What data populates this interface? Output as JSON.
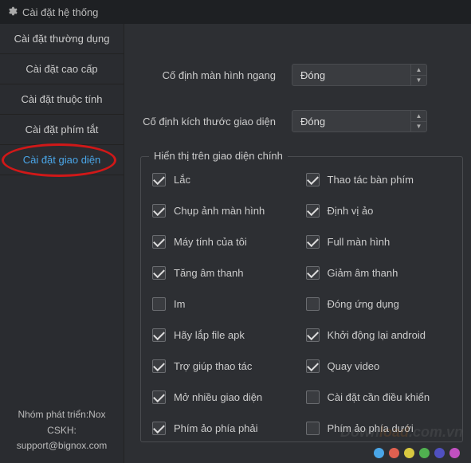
{
  "titlebar": {
    "title": "Cài đặt hệ thống"
  },
  "sidebar": {
    "items": [
      {
        "label": "Cài đặt thường dụng"
      },
      {
        "label": "Cài đặt cao cấp"
      },
      {
        "label": "Cài đặt thuộc tính"
      },
      {
        "label": "Cài đặt phím tắt"
      },
      {
        "label": "Cài đặt giao diện"
      }
    ],
    "activeIndex": 4,
    "footer": {
      "line1": "Nhóm phát triển:Nox",
      "line2": "CSKH:",
      "line3": "support@bignox.com"
    }
  },
  "settings": {
    "fixLandscape": {
      "label": "Cố định màn hình ngang",
      "value": "Đóng"
    },
    "fixSize": {
      "label": "Cố định kích thước giao diện",
      "value": "Đóng"
    }
  },
  "group": {
    "title": "Hiển thị trên giao diện chính",
    "options": [
      {
        "label": "Lắc",
        "checked": true
      },
      {
        "label": "Thao tác bàn phím",
        "checked": true
      },
      {
        "label": "Chụp ảnh màn hình",
        "checked": true
      },
      {
        "label": "Định vị ảo",
        "checked": true
      },
      {
        "label": "Máy tính của tôi",
        "checked": true
      },
      {
        "label": "Full màn hình",
        "checked": true
      },
      {
        "label": "Tăng âm thanh",
        "checked": true
      },
      {
        "label": "Giảm âm thanh",
        "checked": true
      },
      {
        "label": "Im",
        "checked": false
      },
      {
        "label": "Đóng ứng dụng",
        "checked": false
      },
      {
        "label": "Hãy lắp file apk",
        "checked": true
      },
      {
        "label": "Khởi động lại android",
        "checked": true
      },
      {
        "label": "Trợ giúp thao tác",
        "checked": true
      },
      {
        "label": "Quay video",
        "checked": true
      },
      {
        "label": "Mở nhiều giao diện",
        "checked": true
      },
      {
        "label": "Cài đặt cần điều khiển",
        "checked": false
      },
      {
        "label": "Phím ảo phía phải",
        "checked": true
      },
      {
        "label": "Phím ảo phía dưới",
        "checked": false
      }
    ]
  },
  "watermark": {
    "part1": "Down",
    "part2": "load",
    "tld": ".com.vn"
  },
  "dots": [
    "#4aa6e8",
    "#e06050",
    "#d8c840",
    "#50b050",
    "#5050c0",
    "#c050c0"
  ]
}
